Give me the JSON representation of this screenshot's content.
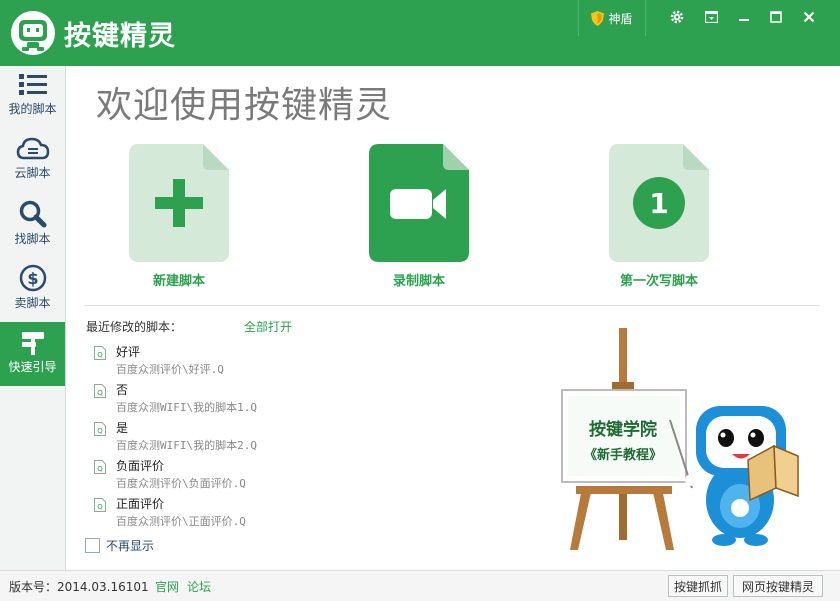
{
  "app": {
    "title": "按键精灵"
  },
  "titlebar": {
    "shield_label": "神盾"
  },
  "sidebar": {
    "items": [
      {
        "label": "我的脚本"
      },
      {
        "label": "云脚本"
      },
      {
        "label": "找脚本"
      },
      {
        "label": "卖脚本"
      },
      {
        "label": "快速引导"
      }
    ]
  },
  "main": {
    "welcome": "欢迎使用按键精灵",
    "cards": [
      {
        "label": "新建脚本"
      },
      {
        "label": "录制脚本"
      },
      {
        "label": "第一次写脚本",
        "badge": "1"
      }
    ],
    "recent_title": "最近修改的脚本：",
    "open_all": "全部打开",
    "recent": [
      {
        "name": "好评",
        "path": "百度众测评价\\好评.Q"
      },
      {
        "name": "否",
        "path": "百度众测WIFI\\我的脚本1.Q"
      },
      {
        "name": "是",
        "path": "百度众测WIFI\\我的脚本2.Q"
      },
      {
        "name": "负面评价",
        "path": "百度众测评价\\负面评价.Q"
      },
      {
        "name": "正面评价",
        "path": "百度众测评价\\正面评价.Q"
      }
    ],
    "no_show": "不再显示",
    "academy": {
      "line1": "按键学院",
      "line2": "《新手教程》"
    }
  },
  "footer": {
    "version": "版本号：2014.03.16101",
    "link_official": "官网",
    "link_forum": "论坛",
    "btn_capture": "按键抓抓",
    "btn_web": "网页按键精灵"
  },
  "colors": {
    "brand": "#2ea150",
    "card_light": "#d5e9d8"
  },
  "icons": {
    "logo": "robot-logo-icon",
    "window": [
      "settings-icon",
      "menu-icon",
      "minimize-icon",
      "maximize-icon",
      "close-icon"
    ]
  }
}
